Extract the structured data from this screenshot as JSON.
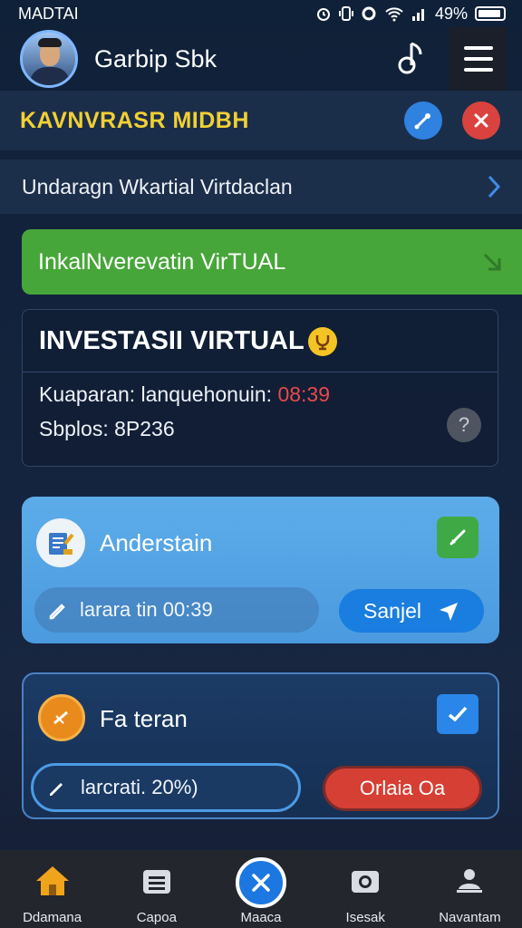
{
  "status_bar": {
    "carrier": "MADTAI",
    "battery": "49%",
    "icons": [
      "alarm-icon",
      "vibrate-icon",
      "settings-icon",
      "wifi-icon",
      "signal-icon",
      "battery-icon"
    ]
  },
  "header": {
    "username": "Garbip Sbk",
    "music_icon": "music-note-icon",
    "menu_icon": "hamburger-menu-icon"
  },
  "banner": {
    "title": "KAVNVRASR MIDBH",
    "edit_icon": "wrench-icon",
    "close_icon": "close-icon"
  },
  "nav_row": {
    "label": "Undaragn Wkartial Virtdaclan"
  },
  "green_card": {
    "label": "InkalNverevatin VirTUAL"
  },
  "invest_card": {
    "title": "INVESTASII VIRTUAL",
    "line1_prefix": "Kuaparan: lanquehonuin: ",
    "timer": "08:39",
    "line2": "Sbplos: 8P236"
  },
  "understand_card": {
    "title": "Anderstain",
    "input_value": "larara tin 00:39",
    "send_label": "Sanjel"
  },
  "fateran_card": {
    "title": "Fa teran",
    "input_value": "larcrati. 20%)",
    "action_label": "Orlaia Oa"
  },
  "bottom_nav": {
    "items": [
      {
        "label": "Ddamana",
        "icon": "home-icon"
      },
      {
        "label": "Capoa",
        "icon": "list-icon"
      },
      {
        "label": "Maaca",
        "icon": "close-icon"
      },
      {
        "label": "Isesak",
        "icon": "camera-icon"
      },
      {
        "label": "Navantam",
        "icon": "notification-icon"
      }
    ],
    "active_index": 2
  },
  "colors": {
    "background": "#14233d",
    "banner_title": "#f2d034",
    "green": "#47a63a",
    "accent_blue": "#1c77e0",
    "danger": "#d63f34",
    "timer": "#e84a4a"
  }
}
